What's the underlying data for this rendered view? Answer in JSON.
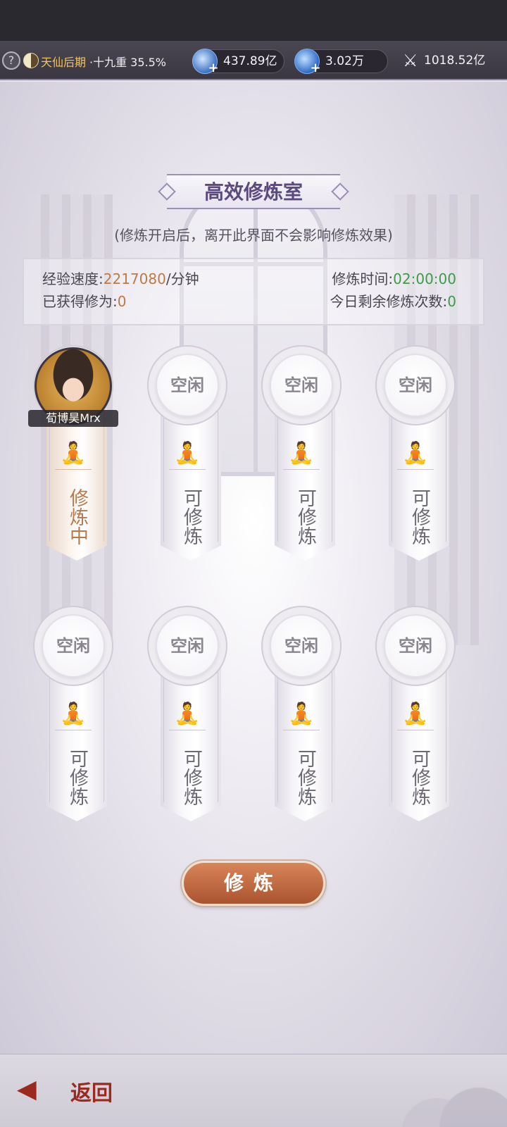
{
  "topbar": {
    "realm_name": "天仙后期",
    "realm_detail": "·十九重 35.5%",
    "resource_1": "437.89亿",
    "resource_2": "3.02万",
    "combat_power": "1018.52亿"
  },
  "room": {
    "title": "高效修炼室",
    "subtitle": "(修炼开启后，离开此界面不会影响修炼效果)",
    "exp_speed_label": "经验速度:",
    "exp_speed_value": "2217080",
    "exp_speed_unit": "/分钟",
    "gained_label": "已获得修为:",
    "gained_value": "0",
    "time_label": "修炼时间:",
    "time_value": "02:00:00",
    "remaining_label": "今日剩余修炼次数:",
    "remaining_value": "0"
  },
  "slots": [
    {
      "status": "active",
      "player": "荀博昊Mrx",
      "state": "修炼中"
    },
    {
      "status": "idle",
      "label": "空闲",
      "state": "可修炼"
    },
    {
      "status": "idle",
      "label": "空闲",
      "state": "可修炼"
    },
    {
      "status": "idle",
      "label": "空闲",
      "state": "可修炼"
    },
    {
      "status": "idle",
      "label": "空闲",
      "state": "可修炼"
    },
    {
      "status": "idle",
      "label": "空闲",
      "state": "可修炼"
    },
    {
      "status": "idle",
      "label": "空闲",
      "state": "可修炼"
    },
    {
      "status": "idle",
      "label": "空闲",
      "state": "可修炼"
    }
  ],
  "actions": {
    "cultivate_label": "修炼",
    "back_label": "返回"
  },
  "icons": {
    "help": "?",
    "plus": "+",
    "sword": "⚔",
    "meditate": "🧘",
    "back": "◀"
  },
  "colors": {
    "accent_orange": "#bb7a4a",
    "accent_green": "#3f9a4a",
    "title_purple": "#5c4a7e",
    "back_red": "#9b2a1e"
  }
}
